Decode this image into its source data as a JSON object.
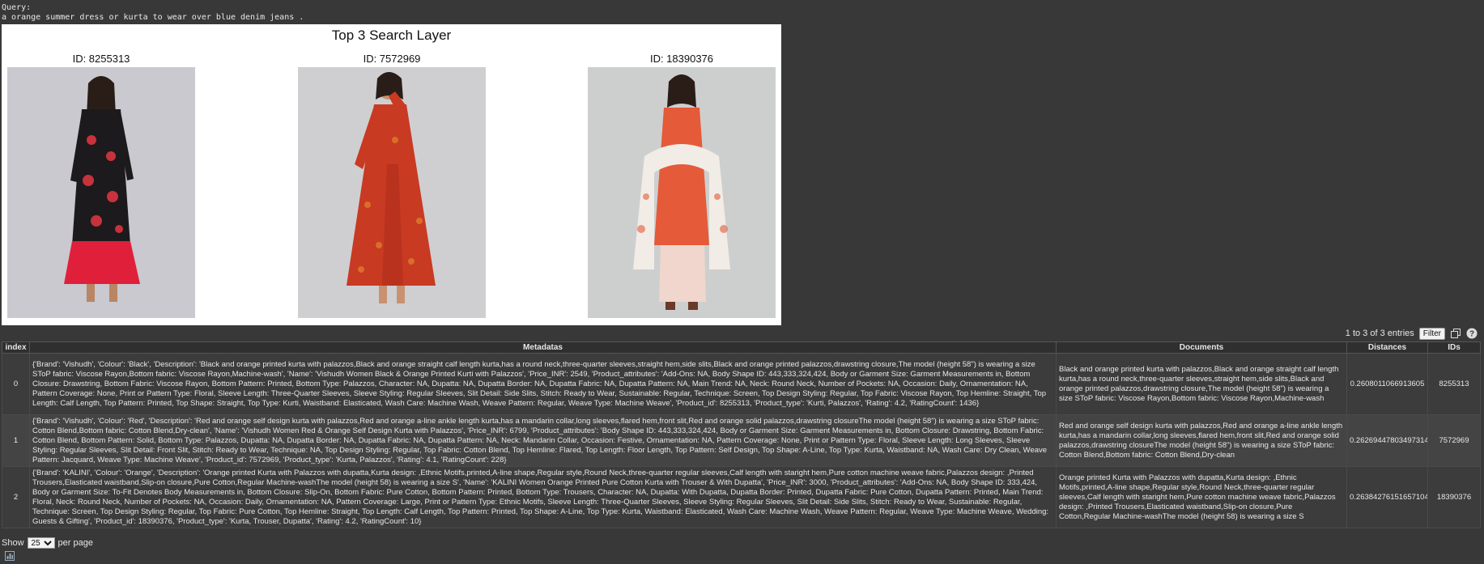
{
  "query": {
    "label": "Query:",
    "text": "a orange summer dress or kurta to wear over blue denim jeans ."
  },
  "figure": {
    "title": "Top 3 Search Layer",
    "images": [
      {
        "caption": "ID: 8255313",
        "garment": "#1c1a1c",
        "accent": "#c8323c",
        "lower": "#e0203a",
        "bg": "#c9c9cf"
      },
      {
        "caption": "ID: 7572969",
        "garment": "#c83a22",
        "accent": "#e0852e",
        "lower": "#b8321e",
        "bg": "#cfcfd2"
      },
      {
        "caption": "ID: 18390376",
        "garment": "#e55a38",
        "accent": "#f2ece6",
        "lower": "#f0d6cc",
        "bg": "#cdcfcf"
      }
    ]
  },
  "toolbar": {
    "entries": "1 to 3 of 3 entries",
    "filter": "Filter",
    "copy_icon": "copy-icon",
    "help_icon": "help-icon"
  },
  "table": {
    "headers": [
      "index",
      "Metadatas",
      "Documents",
      "Distances",
      "IDs"
    ],
    "rows": [
      {
        "index": "0",
        "metadata": "{'Brand': 'Vishudh', 'Colour': 'Black', 'Description': 'Black and orange printed kurta with palazzos,Black and orange straight calf length kurta,has a round neck,three-quarter sleeves,straight hem,side slits,Black and orange printed palazzos,drawstring closure,The model (height 58\") is wearing a size SToP fabric: Viscose Rayon,Bottom fabric: Viscose Rayon,Machine-wash', 'Name': 'Vishudh Women Black & Orange Printed Kurti with Palazzos', 'Price_INR': 2549, 'Product_attributes': 'Add-Ons: NA, Body Shape ID: 443,333,324,424, Body or Garment Size: Garment Measurements in, Bottom Closure: Drawstring, Bottom Fabric: Viscose Rayon, Bottom Pattern: Printed, Bottom Type: Palazzos, Character: NA, Dupatta: NA, Dupatta Border: NA, Dupatta Fabric: NA, Dupatta Pattern: NA, Main Trend: NA, Neck: Round Neck, Number of Pockets: NA, Occasion: Daily, Ornamentation: NA, Pattern Coverage: None, Print or Pattern Type: Floral, Sleeve Length: Three-Quarter Sleeves, Sleeve Styling: Regular Sleeves, Slit Detail: Side Slits, Stitch: Ready to Wear, Sustainable: Regular, Technique: Screen, Top Design Styling: Regular, Top Fabric: Viscose Rayon, Top Hemline: Straight, Top Length: Calf Length, Top Pattern: Printed, Top Shape: Straight, Top Type: Kurti, Waistband: Elasticated, Wash Care: Machine Wash, Weave Pattern: Regular, Weave Type: Machine Weave', 'Product_id': 8255313, 'Product_type': 'Kurti, Palazzos', 'Rating': 4.2, 'RatingCount': 1436}",
        "document": "Black and orange printed kurta with palazzos,Black and orange straight calf length kurta,has a round neck,three-quarter sleeves,straight hem,side slits,Black and orange printed palazzos,drawstring closure,The model (height 58\") is wearing a size SToP fabric: Viscose Rayon,Bottom fabric: Viscose Rayon,Machine-wash",
        "distance": "0.2608011066913605",
        "id": "8255313"
      },
      {
        "index": "1",
        "metadata": "{'Brand': 'Vishudh', 'Colour': 'Red', 'Description': 'Red and orange self design kurta with palazzos,Red and orange a-line ankle length kurta,has a mandarin collar,long sleeves,flared hem,front slit,Red and orange solid palazzos,drawstring closureThe model (height 58\") is wearing a size SToP fabric: Cotton Blend,Bottom fabric: Cotton Blend,Dry-clean', 'Name': 'Vishudh Women Red & Orange Self Design Kurta with Palazzos', 'Price_INR': 6799, 'Product_attributes': 'Body Shape ID: 443,333,324,424, Body or Garment Size: Garment Measurements in, Bottom Closure: Drawstring, Bottom Fabric: Cotton Blend, Bottom Pattern: Solid, Bottom Type: Palazzos, Dupatta: NA, Dupatta Border: NA, Dupatta Fabric: NA, Dupatta Pattern: NA, Neck: Mandarin Collar, Occasion: Festive, Ornamentation: NA, Pattern Coverage: None, Print or Pattern Type: Floral, Sleeve Length: Long Sleeves, Sleeve Styling: Regular Sleeves, Slit Detail: Front Slit, Stitch: Ready to Wear, Technique: NA, Top Design Styling: Regular, Top Fabric: Cotton Blend, Top Hemline: Flared, Top Length: Floor Length, Top Pattern: Self Design, Top Shape: A-Line, Top Type: Kurta, Waistband: NA, Wash Care: Dry Clean, Weave Pattern: Jacquard, Weave Type: Machine Weave', 'Product_id': 7572969, 'Product_type': 'Kurta, Palazzos', 'Rating': 4.1, 'RatingCount': 228}",
        "document": "Red and orange self design kurta with palazzos,Red and orange a-line ankle length kurta,has a mandarin collar,long sleeves,flared hem,front slit,Red and orange solid palazzos,drawstring closureThe model (height 58\") is wearing a size SToP fabric: Cotton Blend,Bottom fabric: Cotton Blend,Dry-clean",
        "distance": "0.26269447803497314",
        "id": "7572969"
      },
      {
        "index": "2",
        "metadata": "{'Brand': 'KALINI', 'Colour': 'Orange', 'Description': 'Orange printed Kurta with Palazzos with dupatta,Kurta design: ,Ethnic Motifs,printed,A-line shape,Regular style,Round Neck,three-quarter regular sleeves,Calf length with staright hem,Pure cotton machine weave fabric,Palazzos design: ,Printed Trousers,Elasticated waistband,Slip-on closure,Pure Cotton,Regular Machine-washThe model (height 58) is wearing a size S', 'Name': 'KALINI Women Orange Printed Pure Cotton Kurta with Trouser & With Dupatta', 'Price_INR': 3000, 'Product_attributes': 'Add-Ons: NA, Body Shape ID: 333,424, Body or Garment Size: To-Fit Denotes Body Measurements in, Bottom Closure: Slip-On, Bottom Fabric: Pure Cotton, Bottom Pattern: Printed, Bottom Type: Trousers, Character: NA, Dupatta: With Dupatta, Dupatta Border: Printed, Dupatta Fabric: Pure Cotton, Dupatta Pattern: Printed, Main Trend: Floral, Neck: Round Neck, Number of Pockets: NA, Occasion: Daily, Ornamentation: NA, Pattern Coverage: Large, Print or Pattern Type: Ethnic Motifs, Sleeve Length: Three-Quarter Sleeves, Sleeve Styling: Regular Sleeves, Slit Detail: Side Slits, Stitch: Ready to Wear, Sustainable: Regular, Technique: Screen, Top Design Styling: Regular, Top Fabric: Pure Cotton, Top Hemline: Straight, Top Length: Calf Length, Top Pattern: Printed, Top Shape: A-Line, Top Type: Kurta, Waistband: Elasticated, Wash Care: Machine Wash, Weave Pattern: Regular, Weave Type: Machine Weave, Wedding: Guests & Gifting', 'Product_id': 18390376, 'Product_type': 'Kurta, Trouser, Dupatta', 'Rating': 4.2, 'RatingCount': 10}",
        "document": "Orange printed Kurta with Palazzos with dupatta,Kurta design: ,Ethnic Motifs,printed,A-line shape,Regular style,Round Neck,three-quarter regular sleeves,Calf length with staright hem,Pure cotton machine weave fabric,Palazzos design: ,Printed Trousers,Elasticated waistband,Slip-on closure,Pure Cotton,Regular Machine-washThe model (height 58) is wearing a size S",
        "distance": "0.26384276151657104",
        "id": "18390376"
      }
    ]
  },
  "footer": {
    "show": "Show",
    "per_page_value": "25",
    "per_page": "per page",
    "chart_icon": "bar-chart-icon"
  }
}
